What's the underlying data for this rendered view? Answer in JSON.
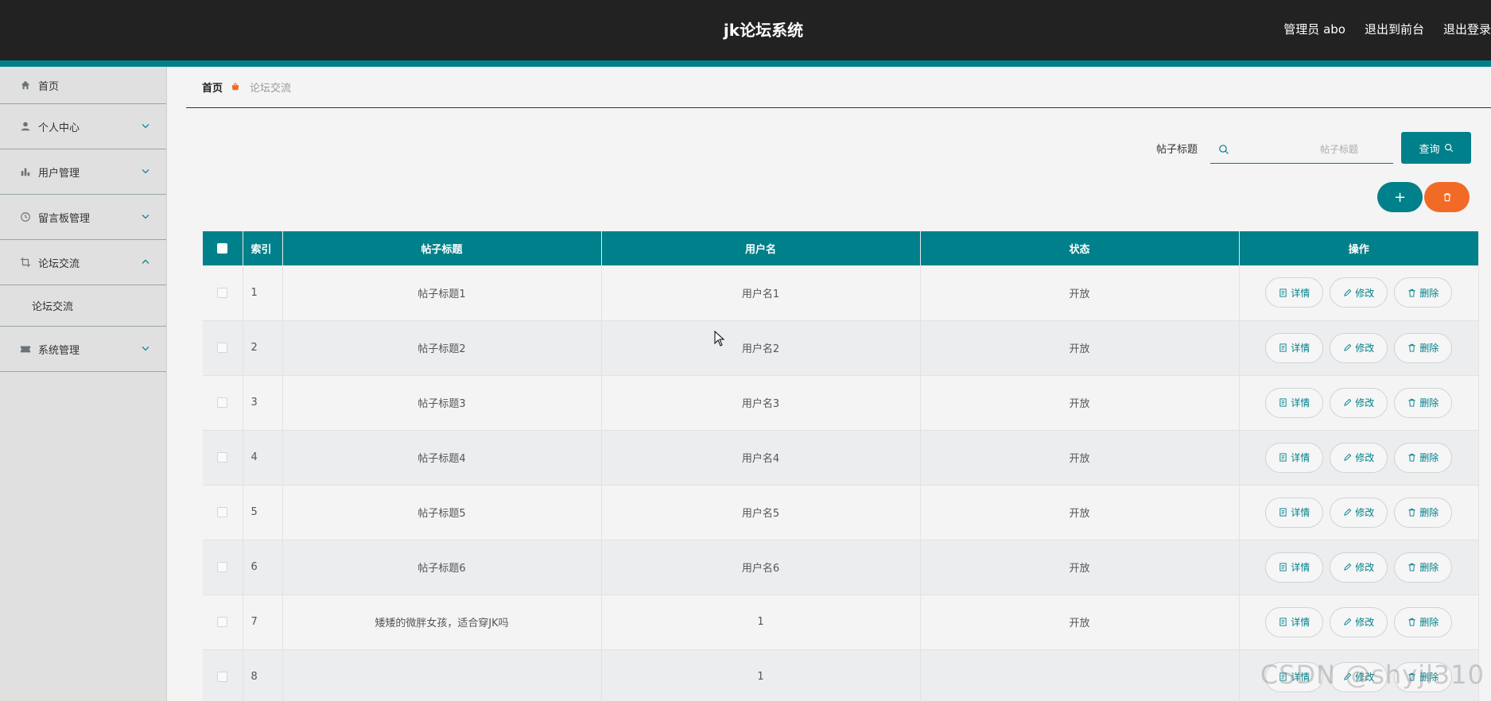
{
  "header": {
    "title": "jk论坛系统",
    "admin_label": "管理员 abo",
    "to_front": "退出到前台",
    "logout": "退出登录"
  },
  "colors": {
    "accent": "#00808a",
    "danger": "#f26b26",
    "topbar": "#222222"
  },
  "sidebar": {
    "items": [
      {
        "label": "首页",
        "icon": "home-icon"
      },
      {
        "label": "个人中心",
        "icon": "user-icon"
      },
      {
        "label": "用户管理",
        "icon": "bar-chart-icon"
      },
      {
        "label": "留言板管理",
        "icon": "clock-icon"
      },
      {
        "label": "论坛交流",
        "icon": "crop-icon",
        "sub": [
          "论坛交流"
        ]
      },
      {
        "label": "系统管理",
        "icon": "ticket-icon"
      }
    ]
  },
  "breadcrumb": {
    "home": "首页",
    "current": "论坛交流"
  },
  "search": {
    "label": "帖子标题",
    "placeholder": "帖子标题",
    "button": "查询"
  },
  "table": {
    "headers": [
      "索引",
      "帖子标题",
      "用户名",
      "状态",
      "操作"
    ],
    "actions": [
      "详情",
      "修改",
      "删除"
    ],
    "rows": [
      {
        "index": "1",
        "title": "帖子标题1",
        "user": "用户名1",
        "status": "开放"
      },
      {
        "index": "2",
        "title": "帖子标题2",
        "user": "用户名2",
        "status": "开放"
      },
      {
        "index": "3",
        "title": "帖子标题3",
        "user": "用户名3",
        "status": "开放"
      },
      {
        "index": "4",
        "title": "帖子标题4",
        "user": "用户名4",
        "status": "开放"
      },
      {
        "index": "5",
        "title": "帖子标题5",
        "user": "用户名5",
        "status": "开放"
      },
      {
        "index": "6",
        "title": "帖子标题6",
        "user": "用户名6",
        "status": "开放"
      },
      {
        "index": "7",
        "title": "矮矮的微胖女孩，适合穿JK吗",
        "user": "1",
        "status": "开放"
      },
      {
        "index": "8",
        "title": "",
        "user": "1",
        "status": ""
      }
    ]
  },
  "watermark": "CSDN @shyjl310"
}
